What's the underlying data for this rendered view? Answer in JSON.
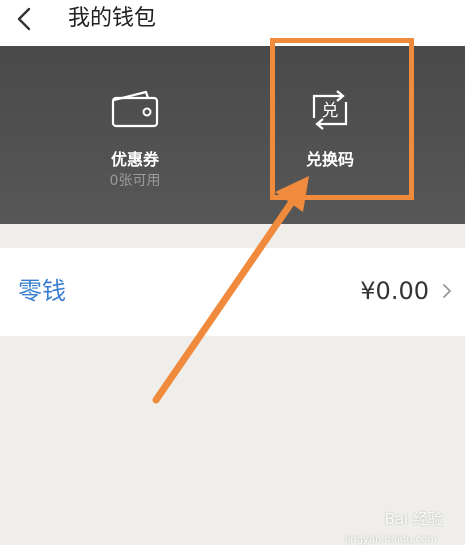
{
  "header": {
    "title": "我的钱包",
    "back_icon": "chevron-left-icon"
  },
  "banner": {
    "coupon": {
      "label": "优惠券",
      "sub": "0张可用",
      "icon": "wallet-icon"
    },
    "redeem": {
      "label": "兑换码",
      "icon": "exchange-icon",
      "icon_glyph": "兑"
    }
  },
  "balance_row": {
    "label": "零钱",
    "value": "¥0.00",
    "icon": "chevron-right-icon"
  },
  "annotation": {
    "highlight_color": "#f08a3c",
    "arrow_color": "#f08a3c"
  },
  "watermark": {
    "text": "Bai 经验",
    "sub": "jingyan.baidu.com"
  },
  "colors": {
    "banner_bg": "#505050",
    "label_blue": "#3a7fd1",
    "page_bg": "#efeeeb"
  }
}
